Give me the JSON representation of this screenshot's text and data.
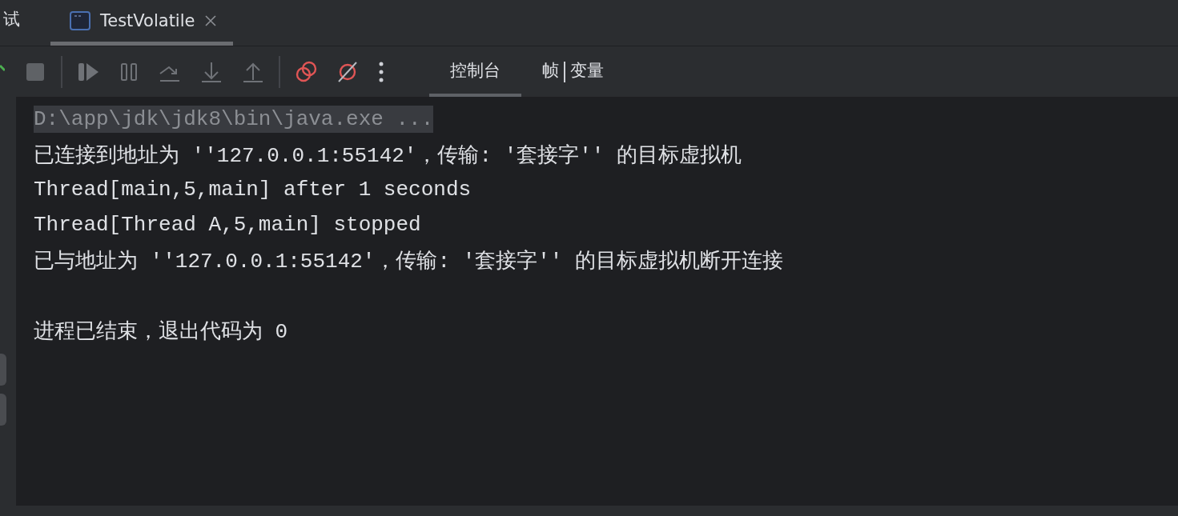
{
  "session_tabs": [
    {
      "label": "试",
      "selected": false,
      "closable": false
    },
    {
      "label": "TestVolatile",
      "selected": true,
      "closable": true
    }
  ],
  "view_tabs": [
    {
      "label": "控制台",
      "selected": true
    },
    {
      "label": "帧",
      "selected": false
    },
    {
      "label": "变量",
      "selected": false
    }
  ],
  "console": {
    "lines": [
      {
        "kind": "command",
        "text": "D:\\app\\jdk\\jdk8\\bin\\java.exe ..."
      },
      {
        "kind": "output",
        "text": "已连接到地址为 ''127.0.0.1:55142'，传输: '套接字'' 的目标虚拟机"
      },
      {
        "kind": "output",
        "text": "Thread[main,5,main] after 1 seconds"
      },
      {
        "kind": "output",
        "text": "Thread[Thread A,5,main] stopped"
      },
      {
        "kind": "output",
        "text": "已与地址为 ''127.0.0.1:55142'，传输: '套接字'' 的目标虚拟机断开连接"
      },
      {
        "kind": "exit",
        "text": "进程已结束，退出代码为 0"
      }
    ]
  }
}
